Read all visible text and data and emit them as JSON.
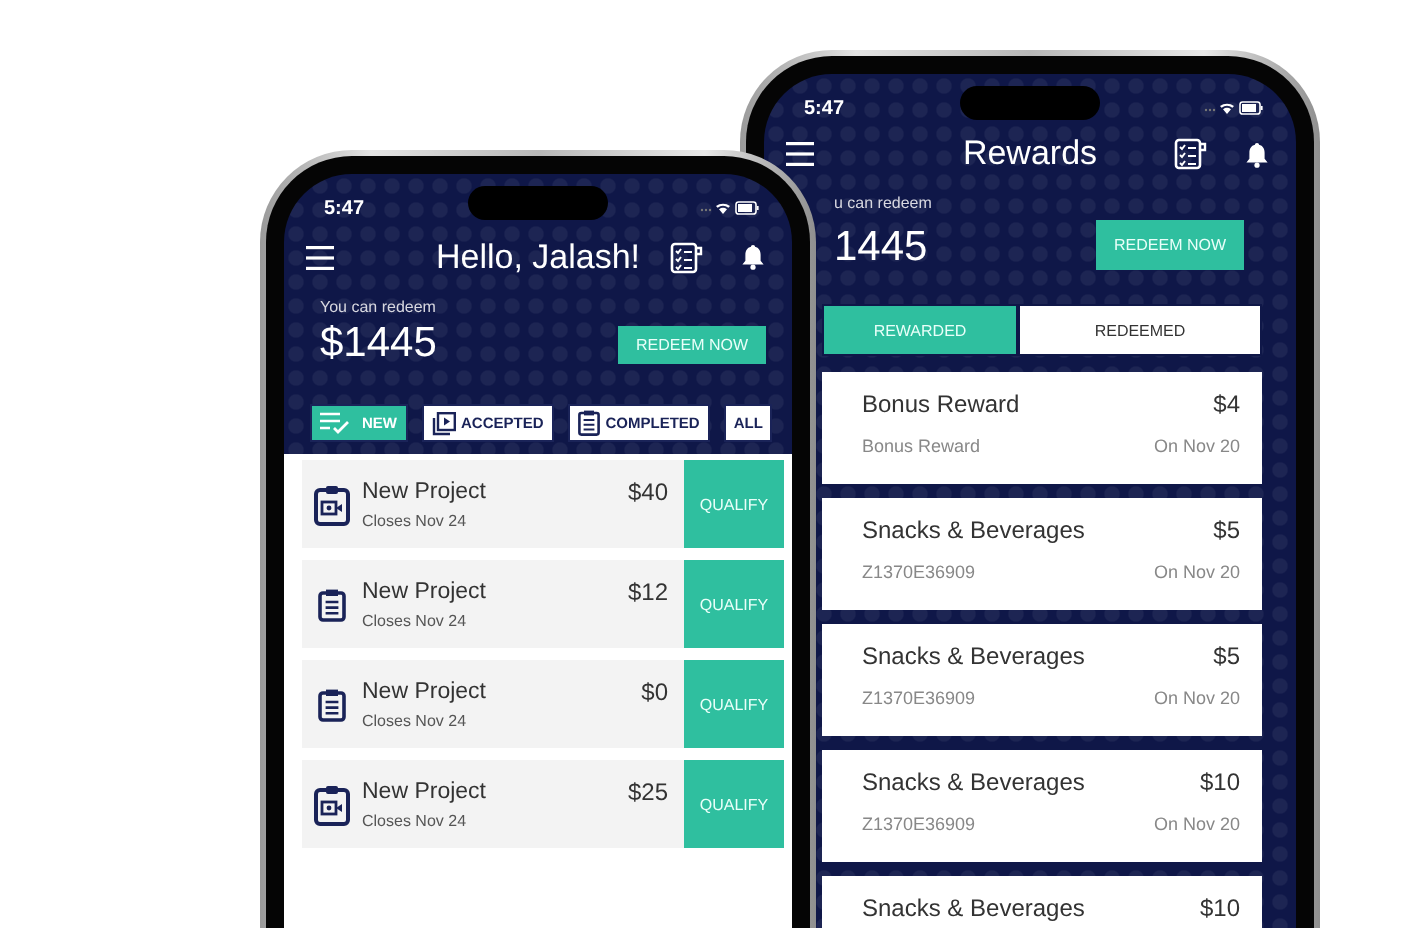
{
  "phones": [
    {
      "kind": "home",
      "status_time": "5:47",
      "title": "Hello, Jalash!",
      "balance_label": "You can redeem",
      "balance": "$1445",
      "redeem_button": "REDEEM NOW",
      "filters": [
        {
          "label": "NEW",
          "kind": "checklist",
          "selected": true
        },
        {
          "label": "ACCEPTED",
          "kind": "media",
          "selected": false
        },
        {
          "label": "COMPLETED",
          "kind": "clipboard",
          "selected": false
        },
        {
          "label": "ALL",
          "kind": "plain",
          "selected": false
        }
      ],
      "projects": [
        {
          "title": "New Project",
          "closes": "Closes Nov 24",
          "amount": "$40",
          "kind": "video",
          "action": "QUALIFY"
        },
        {
          "title": "New Project",
          "closes": "Closes Nov 24",
          "amount": "$12",
          "kind": "document",
          "action": "QUALIFY"
        },
        {
          "title": "New Project",
          "closes": "Closes Nov 24",
          "amount": "$0",
          "kind": "document",
          "action": "QUALIFY"
        },
        {
          "title": "New Project",
          "closes": "Closes Nov 24",
          "amount": "$25",
          "kind": "video",
          "action": "QUALIFY"
        }
      ]
    },
    {
      "kind": "rewards",
      "status_time": "5:47",
      "title": "Rewards",
      "balance_label": "u can redeem",
      "balance": "1445",
      "redeem_button": "REDEEM NOW",
      "tabs": [
        {
          "label": "REWARDED",
          "selected": true
        },
        {
          "label": "REDEEMED",
          "selected": false
        }
      ],
      "rewards": [
        {
          "name": "Bonus Reward",
          "detail": "Bonus Reward",
          "amount": "$4",
          "date": "On Nov 20"
        },
        {
          "name": "Snacks & Beverages",
          "detail": "Z1370E36909",
          "amount": "$5",
          "date": "On Nov 20"
        },
        {
          "name": "Snacks & Beverages",
          "detail": "Z1370E36909",
          "amount": "$5",
          "date": "On Nov 20"
        },
        {
          "name": "Snacks & Beverages",
          "detail": "Z1370E36909",
          "amount": "$10",
          "date": "On Nov 20"
        },
        {
          "name": "Snacks & Beverages",
          "amount": "$10"
        }
      ]
    }
  ]
}
